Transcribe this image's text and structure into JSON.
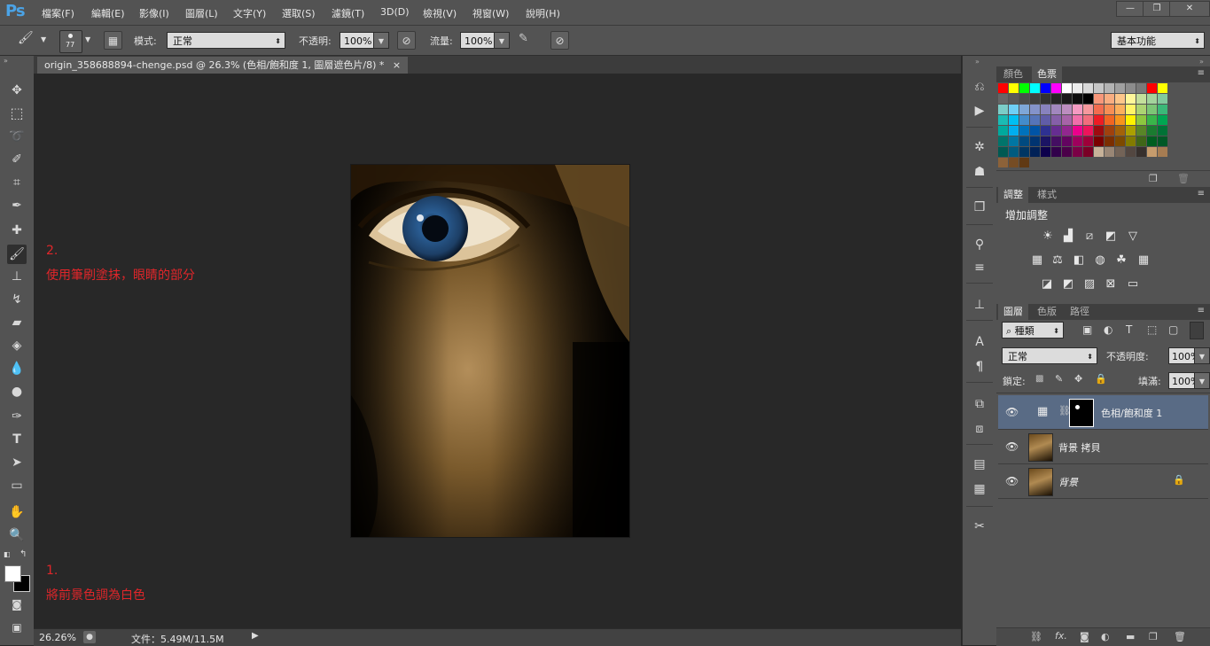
{
  "app": {
    "logo": "Ps"
  },
  "menu": [
    "檔案(F)",
    "編輯(E)",
    "影像(I)",
    "圖層(L)",
    "文字(Y)",
    "選取(S)",
    "濾鏡(T)",
    "3D(D)",
    "檢視(V)",
    "視窗(W)",
    "說明(H)"
  ],
  "window_controls": {
    "minimize": "—",
    "restore": "❐",
    "close": "✕"
  },
  "options": {
    "brush_size": "77",
    "mode_label": "模式:",
    "mode_value": "正常",
    "opacity_label": "不透明:",
    "opacity_value": "100%",
    "flow_label": "流量:",
    "flow_value": "100%",
    "workspace": "基本功能"
  },
  "document": {
    "tab_title": "origin_358688894-chenge.psd @ 26.3% (色相/飽和度 1, 圖層遮色片/8) *",
    "close": "×"
  },
  "annotations": {
    "step2_num": "2.",
    "step2_text": "使用筆刷塗抹，眼睛的部分",
    "step1_num": "1.",
    "step1_text": "將前景色調為白色"
  },
  "status": {
    "zoom": "26.26%",
    "doc_info": "文件：5.49M/11.5M"
  },
  "panels": {
    "color_tabs": [
      "顏色",
      "色票"
    ],
    "adjust_tabs": [
      "調整",
      "樣式"
    ],
    "adjust_title": "增加調整",
    "layers_tabs": [
      "圖層",
      "色版",
      "路徑"
    ],
    "kind_filter": "種類",
    "blend_mode": "正常",
    "opacity_label": "不透明度:",
    "opacity_value": "100%",
    "lock_label": "鎖定:",
    "fill_label": "填滿:",
    "fill_value": "100%",
    "layers": [
      {
        "name": "色相/飽和度 1"
      },
      {
        "name": "背景 拷貝"
      },
      {
        "name": "背景"
      }
    ]
  },
  "colors": {
    "accent_ps": "#4ba3e6",
    "annotation_red": "#e0262a",
    "selected_layer": "#596b85",
    "swatches": [
      [
        "#ff0000",
        "#ffff00",
        "#00ff00",
        "#00ffff",
        "#0000ff",
        "#ff00ff",
        "#ffffff",
        "#ececec",
        "#d9d9d9",
        "#c6c6c6",
        "#b3b3b3",
        "#a0a0a0",
        "#8c8c8c",
        "#797979",
        "#ff0000",
        "#ffff00"
      ],
      [
        "#666666",
        "#595959",
        "#4c4c4c",
        "#404040",
        "#333333",
        "#262626",
        "#1a1a1a",
        "#0d0d0d",
        "#000000",
        "#f7977a",
        "#f9ad81",
        "#fdc68a",
        "#fff79a",
        "#c4df9b",
        "#a3d39c",
        "#82ca9d"
      ],
      [
        "#7bcdc8",
        "#6ecff6",
        "#7ea7d8",
        "#8493ca",
        "#8882be",
        "#a187be",
        "#bc8dbf",
        "#f49ac2",
        "#f6989d",
        "#f26c4f",
        "#f68e55",
        "#fbaf5c",
        "#fff467",
        "#acd372",
        "#7cc576",
        "#3bb878"
      ],
      [
        "#1abbb4",
        "#00bff3",
        "#438ccb",
        "#5574b9",
        "#605ca8",
        "#855fa8",
        "#a763a8",
        "#f06eaa",
        "#f26d7d",
        "#ed1c24",
        "#f26522",
        "#f7941d",
        "#fff200",
        "#8dc63f",
        "#39b54a",
        "#00a651"
      ],
      [
        "#00a99d",
        "#00aeef",
        "#0072bc",
        "#0054a6",
        "#2e3192",
        "#662d91",
        "#92278f",
        "#ec008c",
        "#ed145b",
        "#9e0b0f",
        "#a0410d",
        "#a36209",
        "#aba000",
        "#598527",
        "#1a7b30",
        "#007236"
      ],
      [
        "#00746b",
        "#0076a3",
        "#004a80",
        "#003471",
        "#1b1464",
        "#440e62",
        "#630460",
        "#9e005d",
        "#9e0039",
        "#790000",
        "#7b2e00",
        "#7d4900",
        "#827b00",
        "#406618",
        "#005e20",
        "#005826"
      ],
      [
        "#005952",
        "#005b7f",
        "#003663",
        "#002157",
        "#0d004c",
        "#32004b",
        "#4b0049",
        "#7b0046",
        "#7a0026",
        "#c7b299",
        "#998675",
        "#736357",
        "#534741",
        "#37302d",
        "#c69c6d",
        "#a67c52"
      ],
      [
        "#8c6239",
        "#754c24",
        "#603913"
      ]
    ]
  }
}
